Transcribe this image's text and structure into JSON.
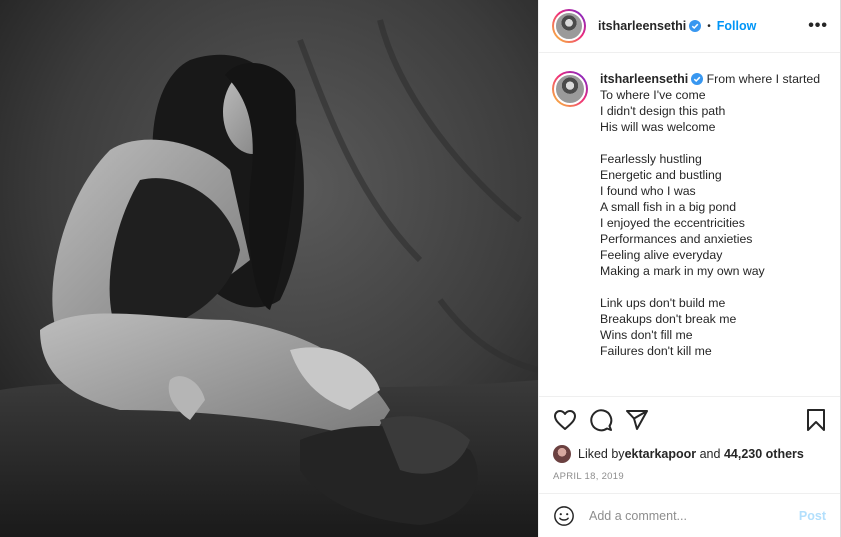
{
  "header": {
    "username": "itsharleensethi",
    "separator": "•",
    "follow_label": "Follow",
    "more_label": "•••"
  },
  "caption": {
    "username": "itsharleensethi",
    "lines": [
      "From where I started",
      "To where I've come",
      "I didn't design this path",
      "His will was welcome",
      "",
      "Fearlessly hustling",
      "Energetic and bustling",
      "I found who I was",
      "A small fish in a big pond",
      "I enjoyed the eccentricities",
      "Performances and anxieties",
      "Feeling alive everyday",
      "Making a mark in my own way",
      "",
      "Link ups don't build me",
      "Breakups don't break me",
      "Wins don't fill me",
      "Failures don't kill me"
    ]
  },
  "likes": {
    "prefix": "Liked by ",
    "user": "ektarkapoor",
    "middle": " and ",
    "count": "44,230 others"
  },
  "date": "APRIL 18, 2019",
  "comment": {
    "placeholder": "Add a comment...",
    "post_label": "Post"
  },
  "colors": {
    "accent": "#0095f6",
    "post_disabled": "#b2dffc",
    "verified": "#3897f0",
    "muted": "#8e8e8e"
  },
  "icons": [
    "heart-icon",
    "comment-icon",
    "share-icon",
    "bookmark-icon",
    "emoji-icon",
    "verified-badge-icon"
  ]
}
